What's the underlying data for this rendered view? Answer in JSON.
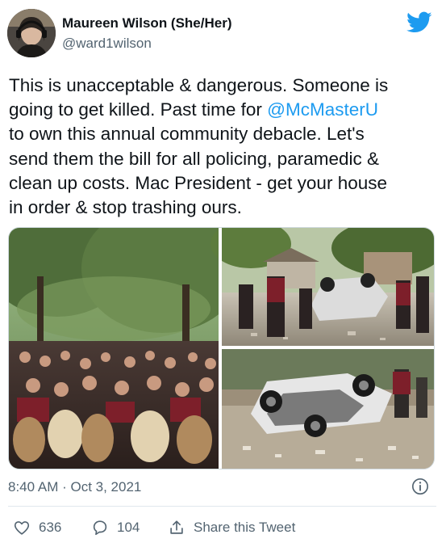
{
  "author": {
    "name": "Maureen Wilson (She/Her)",
    "handle": "@ward1wilson"
  },
  "tweet": {
    "text_before": "This is unacceptable & dangerous. Someone is\ngoing to get killed. Past time for ",
    "mention": "@McMasterU",
    "text_after": "\nto own this annual community debacle. Let's\nsend them the bill for all policing, paramedic &\nclean up costs. Mac President - get your house\nin order & stop trashing ours."
  },
  "timestamp": "8:40 AM · Oct 3, 2021",
  "actions": {
    "likes": "636",
    "replies": "104",
    "share_label": "Share this Tweet"
  },
  "colors": {
    "accent": "#1d9bf0",
    "secondary_text": "#536471"
  },
  "icons": [
    "twitter-bird-icon",
    "info-icon",
    "heart-icon",
    "reply-bubble-icon",
    "share-icon"
  ]
}
